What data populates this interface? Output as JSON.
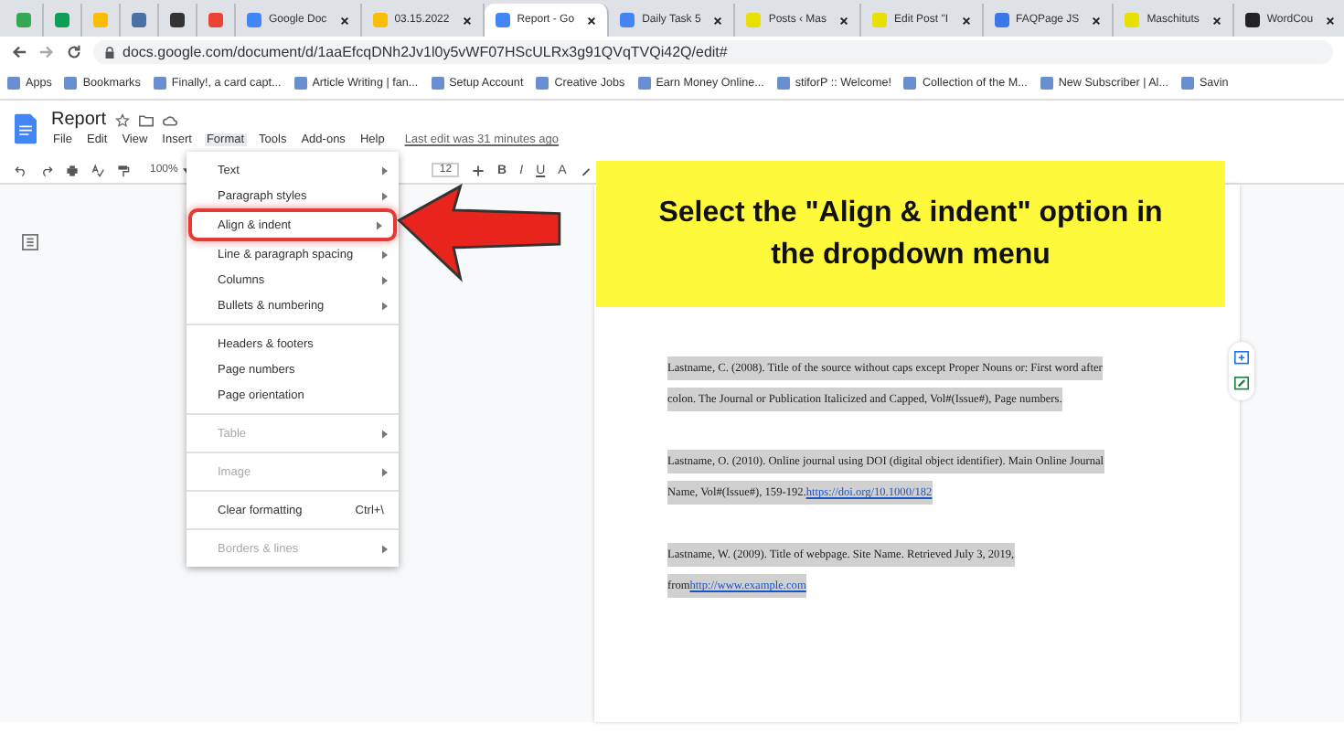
{
  "browser": {
    "tabs": [
      {
        "selected": false,
        "color": "#34a853"
      },
      {
        "selected": false,
        "color": "#0f9d58"
      },
      {
        "selected": false,
        "color": "#fbbc04"
      },
      {
        "selected": false,
        "color": "#4a6fa5"
      },
      {
        "selected": false,
        "color": "#333333"
      },
      {
        "selected": false,
        "color": "#ea4335"
      },
      {
        "label": "Google Doc",
        "selected": false,
        "color": "#4285f4"
      },
      {
        "label": "03.15.2022",
        "selected": false,
        "color": "#fbbc04"
      },
      {
        "label": "Report - Go",
        "selected": true,
        "color": "#4285f4"
      },
      {
        "label": "Daily Task 5",
        "selected": false,
        "color": "#4285f4"
      },
      {
        "label": "Posts ‹ Mas",
        "selected": false,
        "color": "#e8e000"
      },
      {
        "label": "Edit Post \"I",
        "selected": false,
        "color": "#e8e000"
      },
      {
        "label": "FAQPage JS",
        "selected": false,
        "color": "#3b78e7"
      },
      {
        "label": "Maschituts",
        "selected": false,
        "color": "#e8e000"
      },
      {
        "label": "WordCou",
        "selected": false,
        "color": "#222222"
      }
    ],
    "url": "docs.google.com/document/d/1aaEfcqDNh2Jv1l0y5vWF07HScULRx3g91QVqTVQi42Q/edit#",
    "bookmarks": [
      "Apps",
      "Bookmarks",
      "Finally!, a card capt...",
      "Article Writing | fan...",
      "Setup Account",
      "Creative Jobs",
      "Earn Money Online...",
      "stiforP :: Welcome!",
      "Collection of the M...",
      "New Subscriber | Al...",
      "Savin"
    ]
  },
  "doc": {
    "title": "Report",
    "menu": [
      {
        "label": "File",
        "selected": false
      },
      {
        "label": "Edit",
        "selected": false
      },
      {
        "label": "View",
        "selected": false
      },
      {
        "label": "Insert",
        "selected": false
      },
      {
        "label": "Format",
        "selected": true
      },
      {
        "label": "Tools",
        "selected": false
      },
      {
        "label": "Add-ons",
        "selected": false
      },
      {
        "label": "Help",
        "selected": false
      }
    ],
    "last_edit": "Last edit was 31 minutes ago",
    "zoom": "100%",
    "font_size": "12",
    "format_buttons": [
      "B",
      "I",
      "U",
      "A"
    ],
    "paragraphs": [
      {
        "text": "Lastname, C. (2008). Title of the source without caps except Proper Nouns or: First word after colon. The Journal or Publication Italicized and Capped, Vol#(Issue#), Page numbers."
      },
      {
        "text": "Lastname, O. (2010). Online journal using DOI (digital object identifier). Main Online Journal Name, Vol#(Issue#), 159-192.",
        "link": "https://doi.org/10.1000/182"
      },
      {
        "text": "Lastname, W. (2009). Title of webpage. Site Name. Retrieved July 3, 2019, from",
        "link": "http://www.example.com"
      }
    ]
  },
  "format_menu": [
    {
      "kind": "item",
      "label": "Text",
      "submenu": true,
      "disabled": false,
      "selected": false
    },
    {
      "kind": "item",
      "label": "Paragraph styles",
      "submenu": true,
      "disabled": false,
      "selected": false
    },
    {
      "kind": "item",
      "label": "Align & indent",
      "submenu": true,
      "disabled": false,
      "selected": true
    },
    {
      "kind": "item",
      "label": "Line & paragraph spacing",
      "submenu": true,
      "disabled": false,
      "selected": false
    },
    {
      "kind": "item",
      "label": "Columns",
      "submenu": true,
      "disabled": false,
      "selected": false
    },
    {
      "kind": "item",
      "label": "Bullets & numbering",
      "submenu": true,
      "disabled": false,
      "selected": false
    },
    {
      "kind": "separator"
    },
    {
      "kind": "item",
      "label": "Headers & footers",
      "submenu": false,
      "disabled": false,
      "selected": false
    },
    {
      "kind": "item",
      "label": "Page numbers",
      "submenu": false,
      "disabled": false,
      "selected": false
    },
    {
      "kind": "item",
      "label": "Page orientation",
      "submenu": false,
      "disabled": false,
      "selected": false
    },
    {
      "kind": "separator"
    },
    {
      "kind": "item",
      "label": "Table",
      "submenu": true,
      "disabled": true,
      "selected": false
    },
    {
      "kind": "separator"
    },
    {
      "kind": "item",
      "label": "Image",
      "submenu": true,
      "disabled": true,
      "selected": false
    },
    {
      "kind": "separator"
    },
    {
      "kind": "item",
      "label": "Clear formatting",
      "submenu": false,
      "disabled": false,
      "selected": false,
      "shortcut": "Ctrl+\\"
    },
    {
      "kind": "separator"
    },
    {
      "kind": "item",
      "label": "Borders & lines",
      "submenu": true,
      "disabled": true,
      "selected": false
    }
  ],
  "callout": "Select the \"Align & indent\" option in the dropdown menu"
}
